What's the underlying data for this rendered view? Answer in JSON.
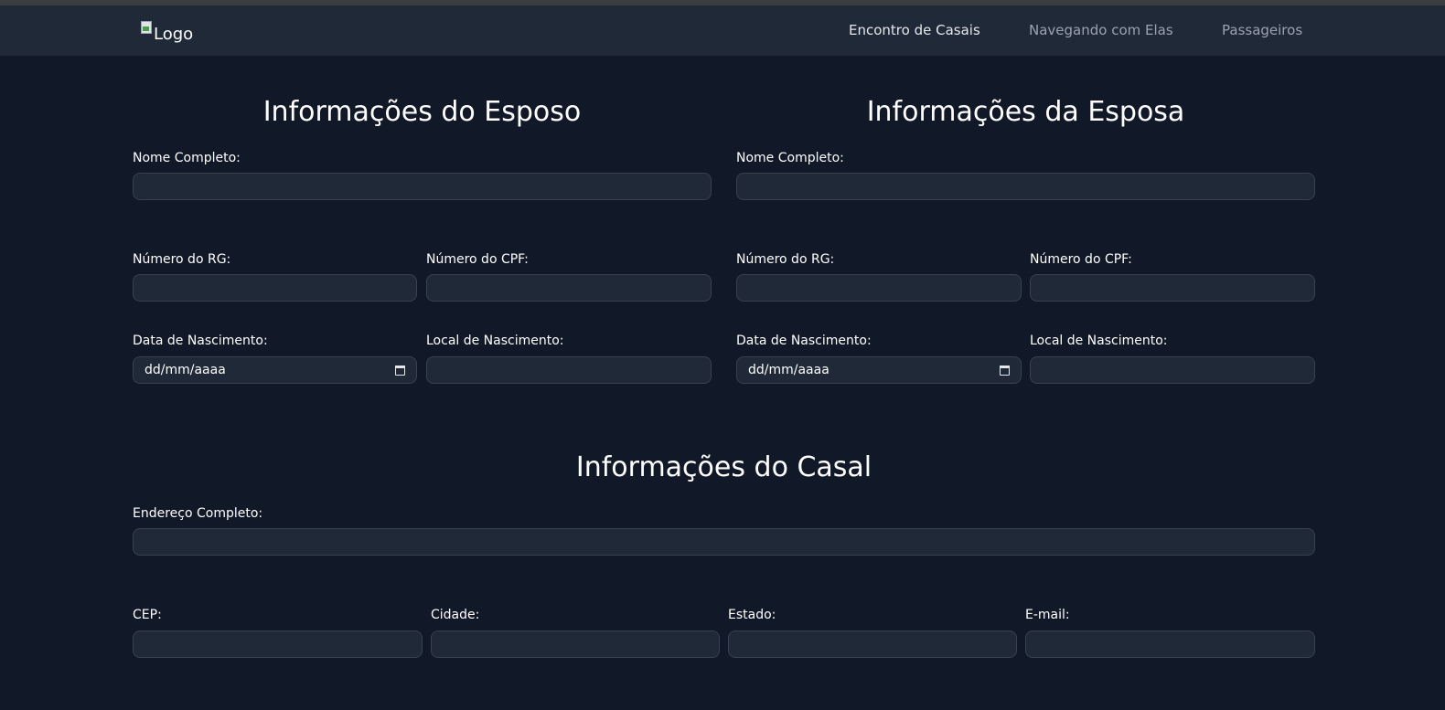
{
  "navbar": {
    "logo_alt": "Logo",
    "links": [
      {
        "label": "Encontro de Casais",
        "active": true
      },
      {
        "label": "Navegando com Elas",
        "active": false
      },
      {
        "label": "Passageiros",
        "active": false
      }
    ]
  },
  "husband": {
    "title": "Informações do Esposo",
    "full_name_label": "Nome Completo:",
    "rg_label": "Número do RG:",
    "cpf_label": "Número do CPF:",
    "birth_date_label": "Data de Nascimento:",
    "birth_date_placeholder": "dd/mm/aaaa",
    "birth_place_label": "Local de Nascimento:"
  },
  "wife": {
    "title": "Informações da Esposa",
    "full_name_label": "Nome Completo:",
    "rg_label": "Número do RG:",
    "cpf_label": "Número do CPF:",
    "birth_date_label": "Data de Nascimento:",
    "birth_date_placeholder": "dd/mm/aaaa",
    "birth_place_label": "Local de Nascimento:"
  },
  "couple": {
    "title": "Informações do Casal",
    "address_label": "Endereço Completo:",
    "cep_label": "CEP:",
    "city_label": "Cidade:",
    "state_label": "Estado:",
    "email_label": "E-mail:"
  },
  "colors": {
    "background": "#111827",
    "navbar": "#1f2937",
    "input_bg": "#1f2937",
    "input_border": "#374151",
    "nav_active": "#e5e7eb",
    "nav_muted": "#9ca3af"
  },
  "icons": {
    "date_picker": "calendar-icon",
    "logo": "broken-image-icon"
  }
}
